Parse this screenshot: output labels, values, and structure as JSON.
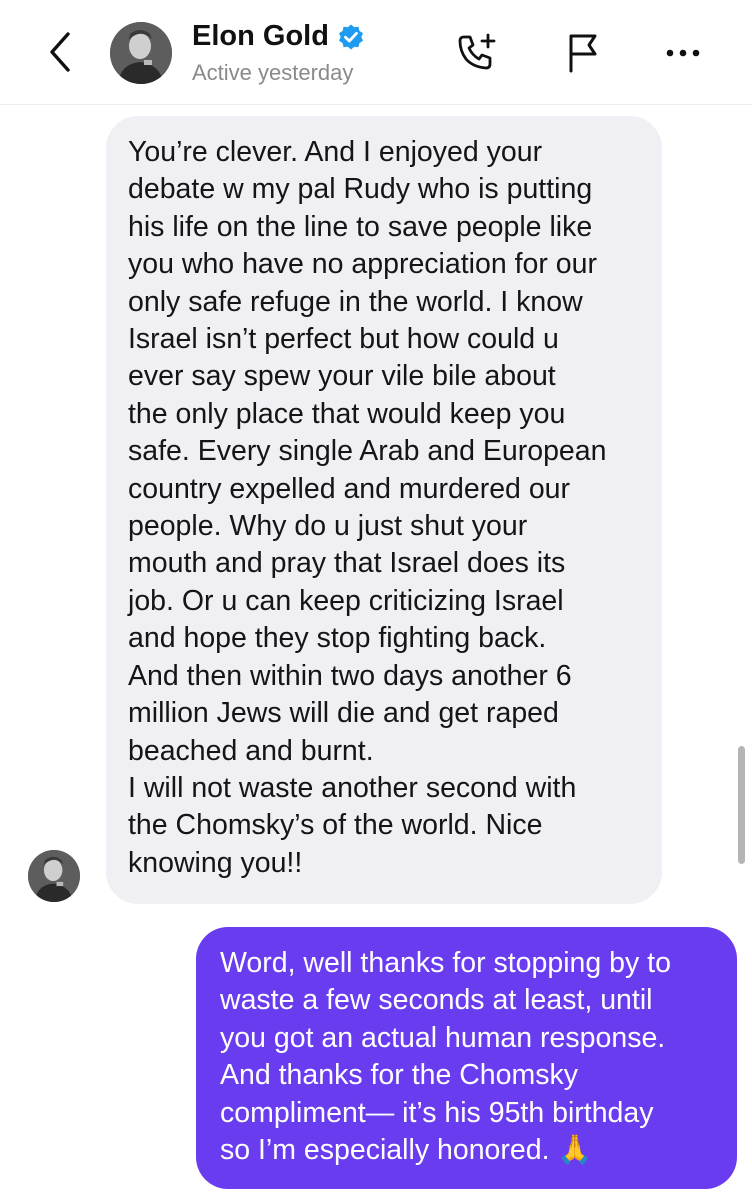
{
  "header": {
    "contact_name": "Elon Gold",
    "status": "Active yesterday",
    "icons": {
      "back": "chevron-left-icon",
      "verified": "verified-badge-icon",
      "call": "phone-plus-icon",
      "report": "flag-icon",
      "more": "more-horizontal-icon"
    }
  },
  "messages": [
    {
      "sender": "contact",
      "text": "You’re clever. And I enjoyed your\ndebate w my pal Rudy who is putting\nhis life on the line to save people like\nyou who have no appreciation for our\nonly safe refuge in the world. I know\nIsrael isn’t perfect but how could u\never say spew your vile bile about\nthe only place that would keep you\nsafe. Every single Arab and European\ncountry expelled and murdered our\npeople. Why do u just shut your\nmouth and pray that Israel does its\njob. Or u can keep criticizing Israel\nand hope they stop fighting back.\nAnd then within two days another 6\nmillion Jews will die and get raped\nbeached and burnt.\nI will not waste another second with\nthe Chomsky’s of the world. Nice\nknowing you!!"
    },
    {
      "sender": "me",
      "text": "Word, well thanks for stopping by to\nwaste a few seconds at least, until\nyou got an actual human response.\nAnd thanks for the Chomsky\ncompliment— it’s his 95th birthday\nso I’m especially honored. 🙏"
    }
  ],
  "colors": {
    "incoming_bubble": "#efeff4",
    "outgoing_bubble": "#6a3cf0",
    "verified": "#1d9bf0"
  }
}
